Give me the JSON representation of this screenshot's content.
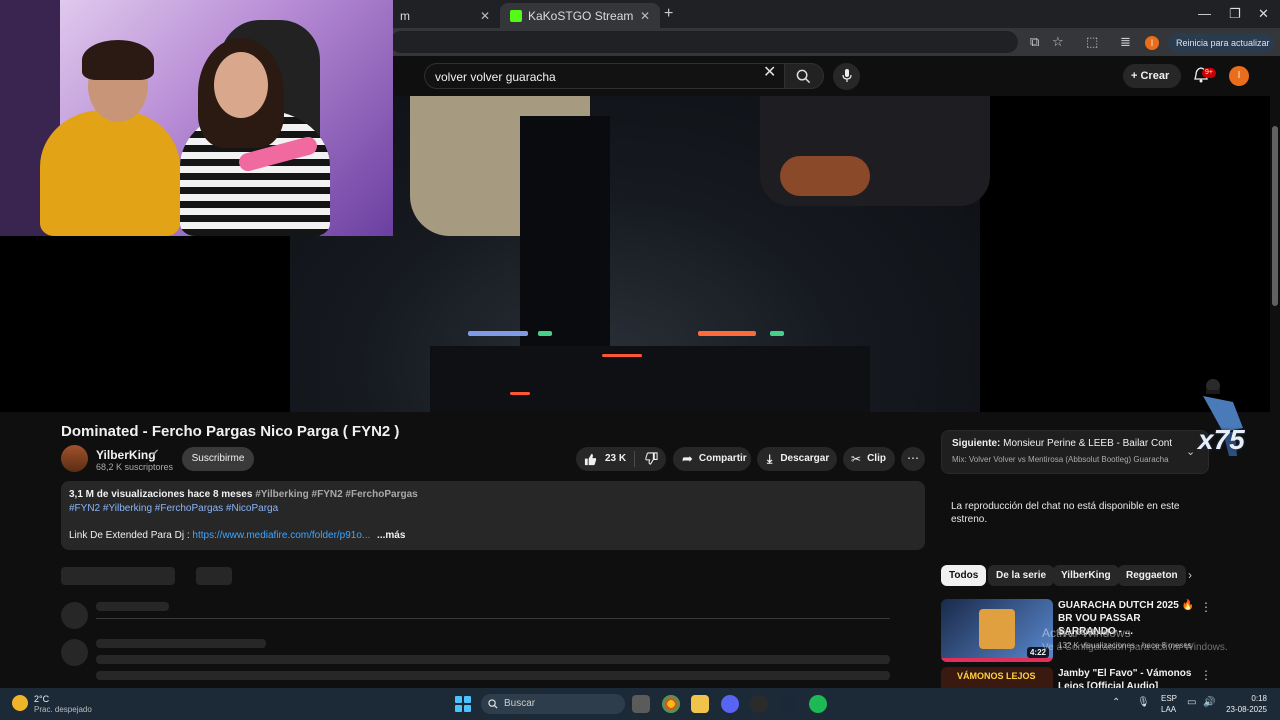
{
  "browser": {
    "tabs": [
      {
        "label": "m"
      },
      {
        "label": "KaKoSTGO Stream - Watch Live"
      }
    ],
    "update_label": "Reinicia para actualizar",
    "profile_initial": "I"
  },
  "masthead": {
    "search_query": "volver volver guaracha",
    "create_label": "Crear",
    "notif_badge": "9+",
    "avatar_initial": "I"
  },
  "video": {
    "title": "Dominated - Fercho Pargas Nico Parga ( FYN2 )",
    "channel": "YilberKing",
    "subscribers": "68,2 K suscriptores",
    "subscribe_label": "Suscribirme",
    "likes": "23 K",
    "share_label": "Compartir",
    "download_label": "Descargar",
    "clip_label": "Clip"
  },
  "description": {
    "stats": "3,1 M de visualizaciones  hace 8 meses",
    "stats_tags": "#Yilberking #FYN2 #FerchoPargas",
    "tags_line": "#FYN2 #Yilberking #FerchoPargas #NicoParga",
    "link_prefix": "Link De Extended Para Dj : ",
    "link_url": "https://www.mediafire.com/folder/p91o...",
    "more_label": "...más"
  },
  "sidebar": {
    "upnext_label": "Siguiente:",
    "upnext_title": "Monsieur Perine & LEEB - Bailar Contigo ...",
    "upnext_sub": "Mix: Volver Volver vs Mentirosa (Abbsolut Bootleg) Guaracha",
    "chat_message": "La reproducción del chat no está disponible en este estreno.",
    "chips": [
      "Todos",
      "De la serie",
      "YilberKing",
      "Reggaeton"
    ],
    "recommendations": [
      {
        "title": "GUARACHA DUTCH 2025 🔥 BR VOU PASSAR SARRANDO - ...",
        "channel": "Ejay Sandoval ✔",
        "meta": "132 K visualizaciones · hace 8 meses",
        "duration": "4:22"
      },
      {
        "title": "Jamby \"El Favo\" - Vámonos Lejos [Official Audio]",
        "thumb_text": "VÁMONOS LEJOS"
      }
    ]
  },
  "overlay": {
    "emote_count": "x75",
    "activate_title": "Activar Windows",
    "activate_sub": "Ve a Configuración para activar Windows."
  },
  "taskbar": {
    "temp": "2°C",
    "weather": "Prac. despejado",
    "search_placeholder": "Buscar",
    "lang1": "ESP",
    "lang2": "LAA",
    "time": "0:18",
    "date": "23-08-2025"
  }
}
